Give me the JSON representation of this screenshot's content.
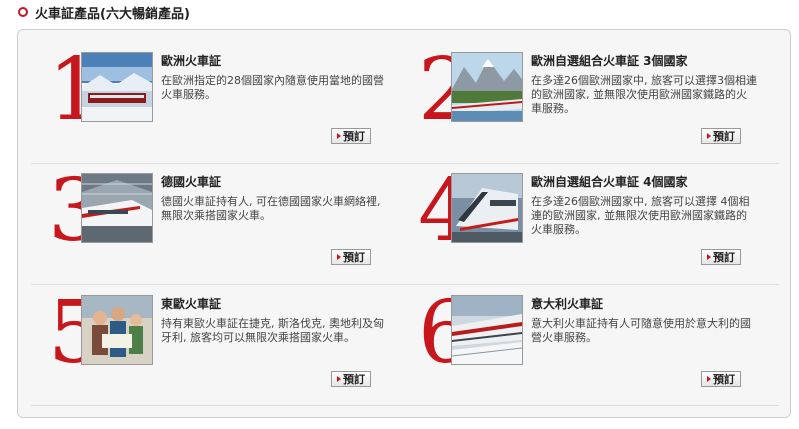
{
  "heading": "火車証產品(六大暢銷產品)",
  "order_label": "預訂",
  "products": [
    {
      "number": "1",
      "title": "歐洲火車証",
      "description": "在歐洲指定的28個國家內隨意使用當地的國營火車服務。",
      "image": "train-winter-landscape"
    },
    {
      "number": "2",
      "title": "歐洲自選組合火車証 3個國家",
      "description": "在多達26個歐洲國家中, 旅客可以選擇3個相連的歐洲國家, 並無限次使用歐洲國家鐵路的火車服務。",
      "image": "train-mountain-lake"
    },
    {
      "number": "3",
      "title": "德國火車証",
      "description": "德國火車証持有人, 可在德國國家火車網絡裡, 無限次乘搭國家火車。",
      "image": "ice-train-station"
    },
    {
      "number": "4",
      "title": "歐洲自選組合火車証 4個國家",
      "description": "在多達26個歐洲國家中, 旅客可以選擇 4個相連的歐洲國家, 並無限次使用歐洲國家鐵路的火車服務。",
      "image": "ice-train-front"
    },
    {
      "number": "5",
      "title": "東歐火車証",
      "description": "持有東歐火車証在捷克, 斯洛伐克, 奧地利及匈牙利, 旅客均可以無限次乘搭國家火車。",
      "image": "travelers-with-map"
    },
    {
      "number": "6",
      "title": "意大利火車証",
      "description": "意大利火車証持有人可隨意使用於意大利的國營火車服務。",
      "image": "italian-train-snow"
    }
  ]
}
